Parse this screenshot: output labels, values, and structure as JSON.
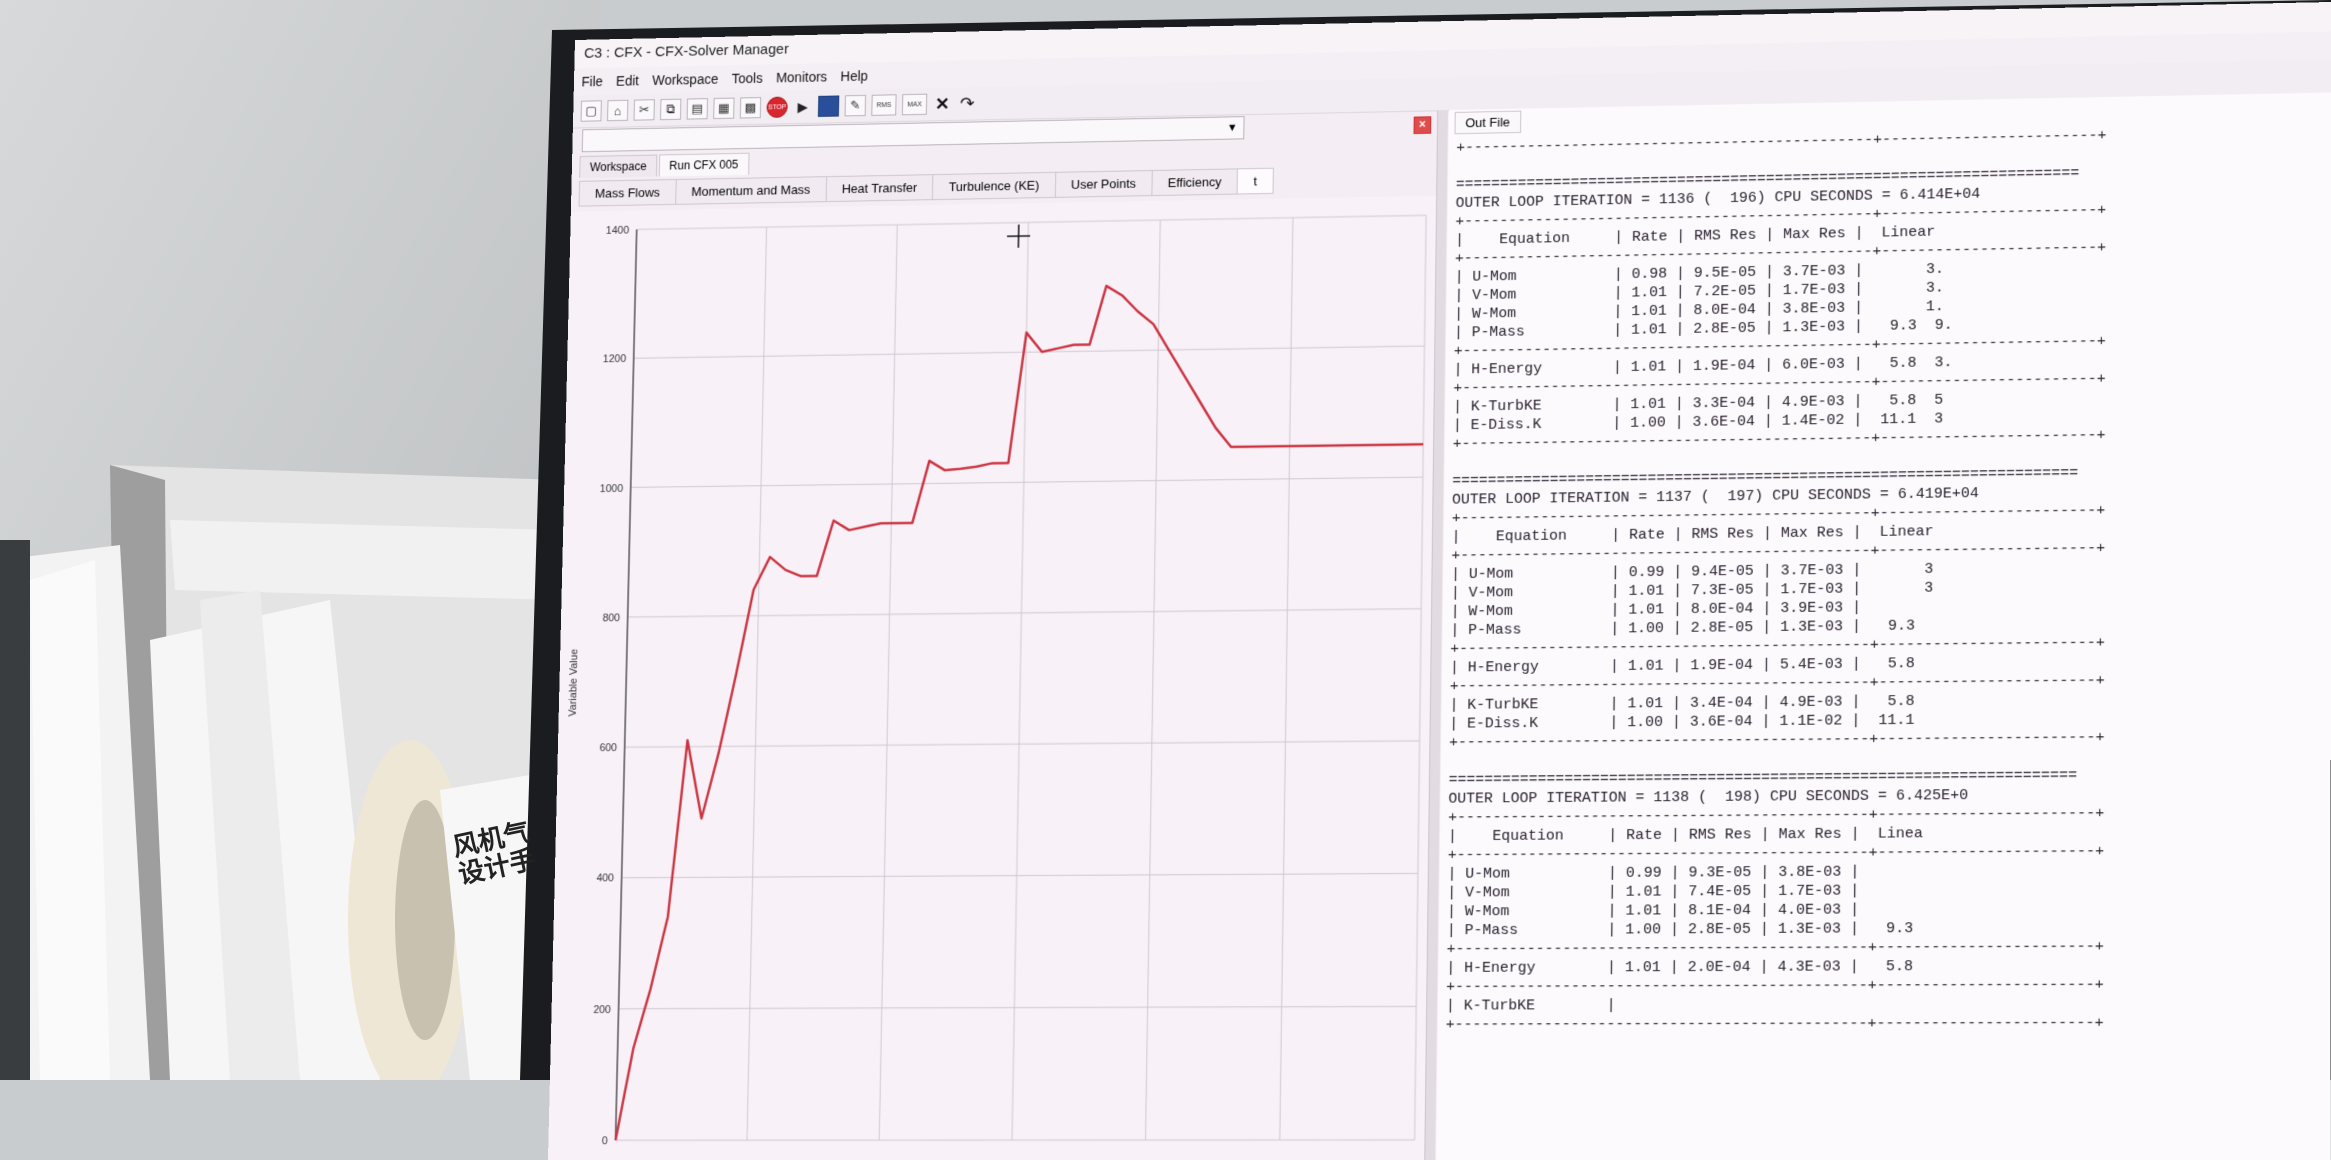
{
  "window": {
    "title": "C3 : CFX - CFX-Solver Manager",
    "menu": [
      "File",
      "Edit",
      "Workspace",
      "Tools",
      "Monitors",
      "Help"
    ],
    "toolbar_icons": [
      "new-icon",
      "open-icon",
      "cut-icon",
      "copy-icon",
      "paste-icon",
      "monitor-icon",
      "grid-icon",
      "stop-icon",
      "play-icon",
      "save-icon",
      "edit-icon",
      "rms-icon",
      "max-icon",
      "close-icon",
      "arrow-icon"
    ],
    "toolbar_text": {
      "rms": "RMS",
      "max": "MAX",
      "stop": "STOP",
      "close": "✕"
    },
    "colors": {
      "plot_line": "#cc3340",
      "screen_bg": "#f4eef4",
      "grid": "#c8c0c8"
    }
  },
  "workspace": {
    "tabs": [
      "Workspace",
      "Run CFX 005"
    ],
    "monitor_tabs": [
      "Mass Flows",
      "Momentum and Mass",
      "Heat Transfer",
      "Turbulence (KE)",
      "User Points",
      "Efficiency",
      "t"
    ]
  },
  "chart_data": {
    "type": "line",
    "xlabel": "",
    "ylabel": "Variable Value",
    "ylim": [
      0,
      1400
    ],
    "ytick_labels": [
      "0",
      "200",
      "400",
      "600",
      "800",
      "1000",
      "1200",
      "1400"
    ],
    "x": [
      0,
      2,
      4,
      6,
      8,
      10,
      12,
      14,
      16,
      18,
      20,
      22,
      24,
      26,
      28,
      30,
      32,
      34,
      36,
      38,
      40,
      42,
      44,
      46,
      48,
      50,
      52,
      54,
      56,
      58,
      60,
      62,
      64,
      66,
      68,
      70,
      72,
      74,
      76,
      78,
      80,
      82,
      84,
      86,
      88,
      90,
      92,
      94,
      96,
      98,
      100
    ],
    "series": [
      {
        "values": [
          0,
          140,
          230,
          340,
          610,
          490,
          590,
          710,
          840,
          890,
          870,
          860,
          860,
          945,
          930,
          935,
          940,
          940,
          940,
          1035,
          1020,
          1022,
          1025,
          1030,
          1030,
          1230,
          1200,
          1205,
          1210,
          1210,
          1300,
          1285,
          1260,
          1240,
          1200,
          1160,
          1120,
          1080,
          1050,
          1050,
          1050,
          1050,
          1050,
          1050,
          1050,
          1050,
          1050,
          1050,
          1050,
          1050,
          1050
        ]
      }
    ]
  },
  "out_file": {
    "tab": "Out File",
    "blocks": [
      {
        "header": "OUTER LOOP ITERATION = 1136 (  196) CPU SECONDS = 6.414E+04",
        "table_header": "|    Equation     | Rate | RMS Res | Max Res |  Linear",
        "rows": [
          "| U-Mom           | 0.98 | 9.5E-05 | 3.7E-03 |       3.",
          "| V-Mom           | 1.01 | 7.2E-05 | 1.7E-03 |       3.",
          "| W-Mom           | 1.01 | 8.0E-04 | 3.8E-03 |       1.",
          "| P-Mass          | 1.01 | 2.8E-05 | 1.3E-03 |   9.3  9."
        ],
        "energy": "| H-Energy        | 1.01 | 1.9E-04 | 6.0E-03 |   5.8  3.",
        "turb": [
          "| K-TurbKE        | 1.01 | 3.3E-04 | 4.9E-03 |   5.8  5",
          "| E-Diss.K        | 1.00 | 3.6E-04 | 1.4E-02 |  11.1  3"
        ]
      },
      {
        "header": "OUTER LOOP ITERATION = 1137 (  197) CPU SECONDS = 6.419E+04",
        "table_header": "|    Equation     | Rate | RMS Res | Max Res |  Linear",
        "rows": [
          "| U-Mom           | 0.99 | 9.4E-05 | 3.7E-03 |       3",
          "| V-Mom           | 1.01 | 7.3E-05 | 1.7E-03 |       3",
          "| W-Mom           | 1.01 | 8.0E-04 | 3.9E-03 |",
          "| P-Mass          | 1.00 | 2.8E-05 | 1.3E-03 |   9.3"
        ],
        "energy": "| H-Energy        | 1.01 | 1.9E-04 | 5.4E-03 |   5.8",
        "turb": [
          "| K-TurbKE        | 1.01 | 3.4E-04 | 4.9E-03 |   5.8",
          "| E-Diss.K        | 1.00 | 3.6E-04 | 1.1E-02 |  11.1"
        ]
      },
      {
        "header": "OUTER LOOP ITERATION = 1138 (  198) CPU SECONDS = 6.425E+0",
        "table_header": "|    Equation     | Rate | RMS Res | Max Res |  Linea",
        "rows": [
          "| U-Mom           | 0.99 | 9.3E-05 | 3.8E-03 |",
          "| V-Mom           | 1.01 | 7.4E-05 | 1.7E-03 |",
          "| W-Mom           | 1.01 | 8.1E-04 | 4.0E-03 |",
          "| P-Mass          | 1.00 | 2.8E-05 | 1.3E-03 |   9.3"
        ],
        "energy": "| H-Energy        | 1.01 | 2.0E-04 | 4.3E-03 |   5.8",
        "turb": [
          "| K-TurbKE        |"
        ]
      }
    ]
  },
  "scene": {
    "paper_text": "风机气\n设计手"
  }
}
